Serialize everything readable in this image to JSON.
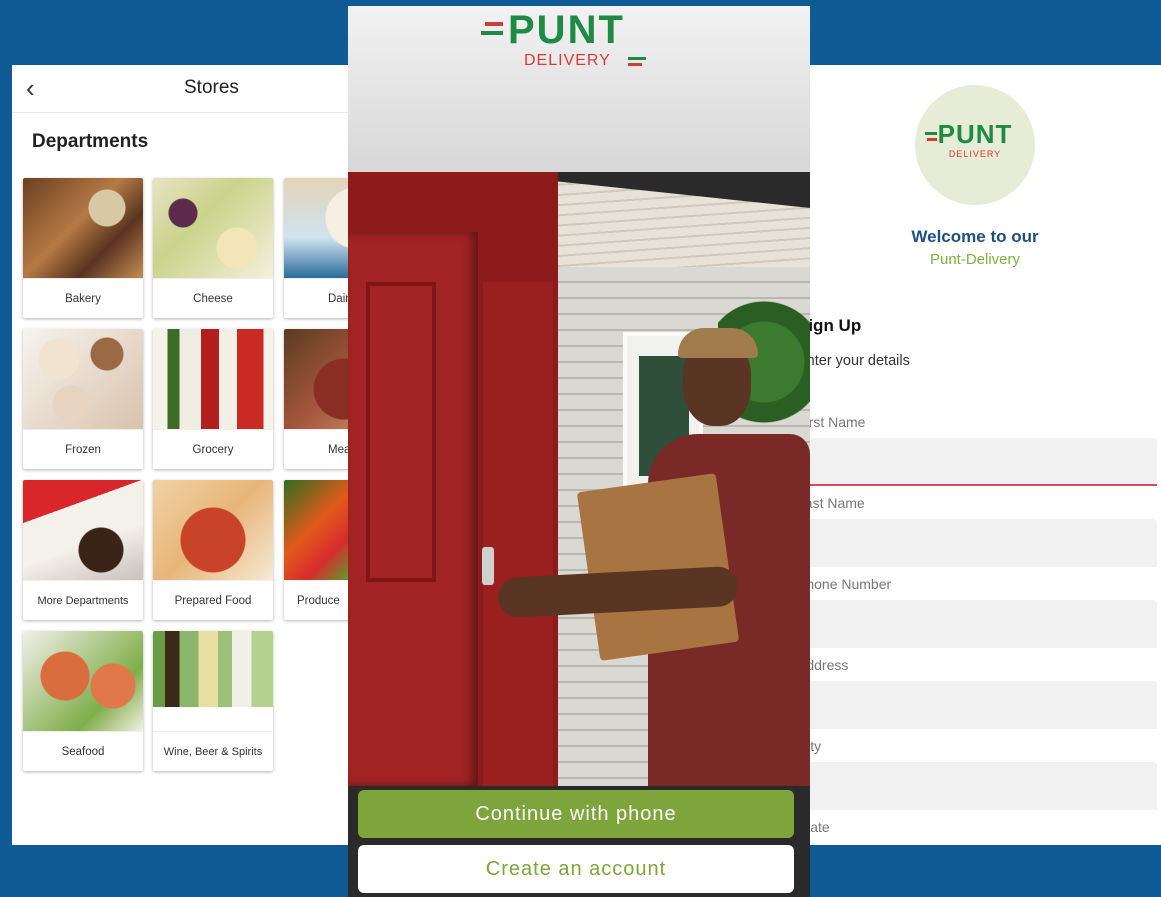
{
  "brand": {
    "name": "PUNT",
    "sub": "DELIVERY",
    "green": "#1e8a44",
    "red": "#d43a3a",
    "accent": "#7ea43c",
    "background": "#105a96"
  },
  "stores": {
    "back_icon": "chevron-left-icon",
    "title": "Stores",
    "section_title": "Departments",
    "departments": [
      {
        "label": "Bakery"
      },
      {
        "label": "Cheese"
      },
      {
        "label": "Dairy"
      },
      {
        "label": "Frozen"
      },
      {
        "label": "Grocery"
      },
      {
        "label": "Meat"
      },
      {
        "label": "More Departments"
      },
      {
        "label": "Prepared Food"
      },
      {
        "label": "Produce"
      },
      {
        "label": "Seafood"
      },
      {
        "label": "Wine, Beer & Spirits"
      }
    ]
  },
  "onboarding": {
    "continue_label": "Continue with phone",
    "create_label": "Create an account"
  },
  "signup": {
    "welcome": "Welcome to our",
    "welcome_sub": "Punt-Delivery",
    "title": "Sign Up",
    "subtitle": "Enter your details",
    "fields": [
      {
        "label": "First Name",
        "value": ""
      },
      {
        "label": "Last Name",
        "value": ""
      },
      {
        "label": "Phone Number",
        "value": ""
      },
      {
        "label": "Address",
        "value": ""
      },
      {
        "label": "City",
        "value": ""
      },
      {
        "label": "State",
        "value": ""
      }
    ]
  }
}
